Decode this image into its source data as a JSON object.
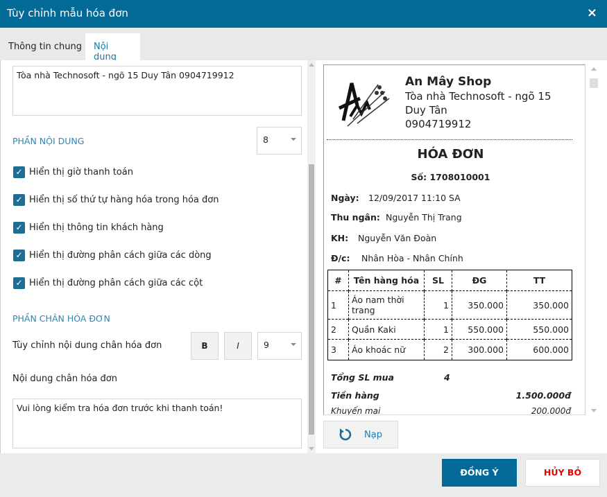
{
  "dialog": {
    "title": "Tùy chỉnh mẫu hóa đơn",
    "close_icon": "×"
  },
  "tabs": [
    {
      "label": "Thông tin chung"
    },
    {
      "label": "Nội dung"
    }
  ],
  "left": {
    "address_text": "Tòa nhà Technosoft - ngõ 15 Duy Tân  0904719912",
    "content_section": "PHẦN NỘI DUNG",
    "content_font_size": "8",
    "checkboxes": [
      {
        "label": "Hiển thị giờ thanh toán",
        "checked": true
      },
      {
        "label": "Hiển thị số thứ tự hàng hóa trong hóa đơn",
        "checked": true
      },
      {
        "label": "Hiển thị thông tin khách hàng",
        "checked": true
      },
      {
        "label": "Hiển thị đường phân cách giữa các dòng",
        "checked": true
      },
      {
        "label": "Hiển thị đường phân cách giữa các cột",
        "checked": true
      }
    ],
    "footer_section": "PHẦN CHÂN HÓA ĐƠN",
    "footer_custom_label": "Tùy chỉnh nội dung chân hóa đơn",
    "bold_label": "B",
    "italic_label": "I",
    "footer_font_size": "9",
    "footer_content_label": "Nội dung chân hóa đơn",
    "footer_text": "Vui lòng kiểm tra hóa đơn trước khi thanh toán!"
  },
  "preview": {
    "shop_name": "An Mây Shop",
    "address1": "Tòa nhà Technosoft - ngõ 15",
    "address2": "Duy Tân",
    "phone": "0904719912",
    "title": "HÓA ĐƠN",
    "number": "Số: 1708010001",
    "date_label": "Ngày:",
    "date": "12/09/2017 11:10 SA",
    "cashier_label": "Thu ngân:",
    "cashier": "Nguyễn Thị Trang",
    "customer_label": "KH:",
    "customer": "Nguyễn Văn Đoàn",
    "addr_label": "Đ/c:",
    "addr": "Nhân Hòa - Nhân Chính",
    "columns": [
      "#",
      "Tên hàng hóa",
      "SL",
      "ĐG",
      "TT"
    ],
    "rows": [
      [
        "1",
        "Áo nam thời trang",
        "1",
        "350.000",
        "350.000"
      ],
      [
        "2",
        "Quần Kaki",
        "1",
        "550.000",
        "550.000"
      ],
      [
        "3",
        "Áo khoác nữ",
        "2",
        "300.000",
        "600.000"
      ]
    ],
    "total_qty_label": "Tổng SL mua",
    "total_qty": "4",
    "subtotal_label": "Tiền hàng",
    "subtotal": "1.500.000đ",
    "discount_label": "Khuyến mại",
    "discount": "200.000đ"
  },
  "reload_label": "Nạp",
  "ok_label": "ĐỒNG Ý",
  "cancel_label": "HỦY BỎ"
}
